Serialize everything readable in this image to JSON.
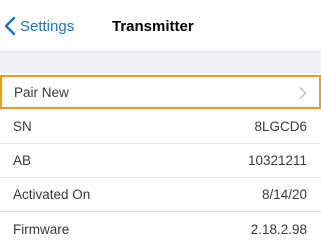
{
  "nav": {
    "back_label": "Settings",
    "title": "Transmitter"
  },
  "rows": [
    {
      "label": "Pair New",
      "value": ""
    },
    {
      "label": "SN",
      "value": "8LGCD6"
    },
    {
      "label": "AB",
      "value": "10321211"
    },
    {
      "label": "Activated On",
      "value": "8/14/20"
    },
    {
      "label": "Firmware",
      "value": "2.18.2.98"
    }
  ],
  "colors": {
    "accent": "#1a73c8",
    "highlight": "#f0962b",
    "section_background": "#efeff4"
  },
  "icons": {
    "back": "chevron-left-icon",
    "disclosure": "chevron-right-icon"
  }
}
